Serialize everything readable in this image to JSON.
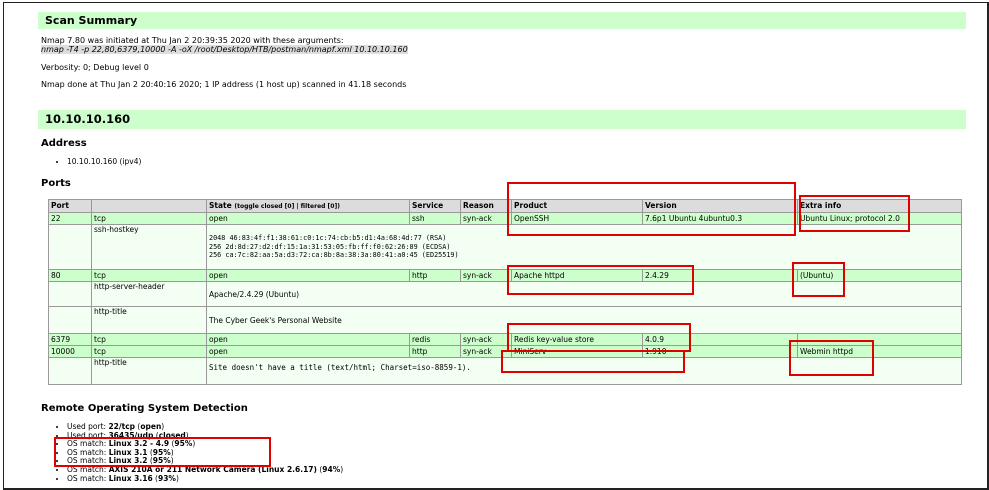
{
  "summary": {
    "title": "Scan Summary",
    "init_line": "Nmap 7.80 was initiated at Thu Jan 2 20:39:35 2020 with these arguments:",
    "args": "nmap -T4 -p 22,80,6379,10000 -A -oX /root/Desktop/HTB/postman/nmapf.xml 10.10.10.160",
    "verbosity": "Verbosity: 0; Debug level 0",
    "done": "Nmap done at Thu Jan 2 20:40:16 2020; 1 IP address (1 host up) scanned in 41.18 seconds"
  },
  "host": {
    "title": "10.10.10.160",
    "address_heading": "Address",
    "address": "10.10.10.160 (ipv4)",
    "ports_heading": "Ports"
  },
  "table": {
    "headers": {
      "port": "Port",
      "state": "State",
      "state_toggle": "(toggle closed [0] | filtered [0])",
      "service": "Service",
      "reason": "Reason",
      "product": "Product",
      "version": "Version",
      "extra": "Extra info"
    },
    "rows": [
      {
        "port": "22",
        "proto": "tcp",
        "state": "open",
        "service": "ssh",
        "reason": "syn-ack",
        "product": "OpenSSH",
        "version": "7.6p1 Ubuntu 4ubuntu0.3",
        "extra": "Ubuntu Linux; protocol 2.0"
      },
      {
        "port": "80",
        "proto": "tcp",
        "state": "open",
        "service": "http",
        "reason": "syn-ack",
        "product": "Apache httpd",
        "version": "2.4.29",
        "extra": "(Ubuntu)"
      },
      {
        "port": "6379",
        "proto": "tcp",
        "state": "open",
        "service": "redis",
        "reason": "syn-ack",
        "product": "Redis key-value store",
        "version": "4.0.9",
        "extra": ""
      },
      {
        "port": "10000",
        "proto": "tcp",
        "state": "open",
        "service": "http",
        "reason": "syn-ack",
        "product": "MiniServ",
        "version": "1.910",
        "extra": "Webmin httpd"
      }
    ],
    "scripts": {
      "ssh_hostkey_name": "ssh-hostkey",
      "ssh_hostkey_1": "2048 46:83:4f:f1:38:61:c0:1c:74:cb:b5:d1:4a:68:4d:77 (RSA)",
      "ssh_hostkey_2": "256 2d:8d:27:d2:df:15:1a:31:53:05:fb:ff:f0:62:26:89 (ECDSA)",
      "ssh_hostkey_3": "256 ca:7c:82:aa:5a:d3:72:ca:8b:8a:38:3a:80:41:a0:45 (ED25519)",
      "http_server_header_name": "http-server-header",
      "http_server_header": "Apache/2.4.29 (Ubuntu)",
      "http_title_name_80": "http-title",
      "http_title_80": "The Cyber Geek's Personal Website",
      "http_title_name_10000": "http-title",
      "http_title_10000": "Site doesn't have a title (text/html; Charset=iso-8859-1)."
    }
  },
  "os": {
    "heading": "Remote Operating System Detection",
    "items": [
      {
        "prefix": "Used port: ",
        "bold": "22/tcp",
        "suffix_pre": " (",
        "suffix_bold": "open",
        "suffix_post": ")"
      },
      {
        "prefix": "Used port: ",
        "bold": "36435/udp",
        "suffix_pre": " (",
        "suffix_bold": "closed",
        "suffix_post": ")"
      },
      {
        "prefix": "OS match: ",
        "bold": "Linux 3.2 - 4.9",
        "suffix_pre": " (",
        "suffix_bold": "95%",
        "suffix_post": ")"
      },
      {
        "prefix": "OS match: ",
        "bold": "Linux 3.1",
        "suffix_pre": " (",
        "suffix_bold": "95%",
        "suffix_post": ")"
      },
      {
        "prefix": "OS match: ",
        "bold": "Linux 3.2",
        "suffix_pre": " (",
        "suffix_bold": "95%",
        "suffix_post": ")"
      },
      {
        "prefix": "OS match: ",
        "bold": "AXIS 210A or 211 Network Camera (Linux 2.6.17)",
        "suffix_pre": " (",
        "suffix_bold": "94%",
        "suffix_post": ")"
      },
      {
        "prefix": "OS match: ",
        "bold": "Linux 3.16",
        "suffix_pre": " (",
        "suffix_bold": "93%",
        "suffix_post": ")"
      }
    ]
  },
  "annotation_color": "#e00000",
  "header_bg": "#ccffcc"
}
